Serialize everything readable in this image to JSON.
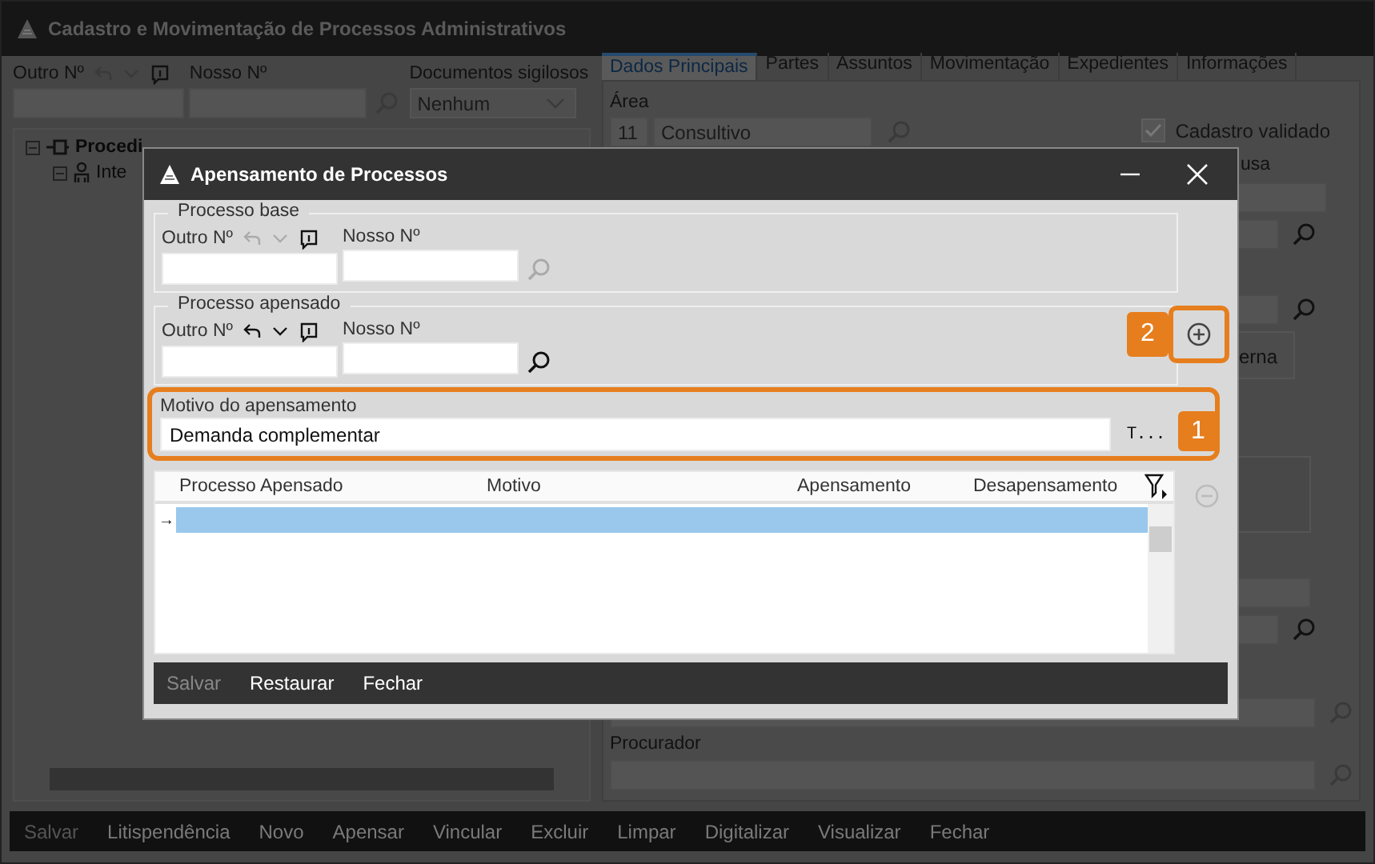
{
  "window": {
    "title": "Cadastro e Movimentação de Processos Administrativos"
  },
  "header_fields": {
    "outro_label": "Outro Nº",
    "nosso_label": "Nosso Nº",
    "sigilosos_label": "Documentos sigilosos",
    "sigilosos_value": "Nenhum"
  },
  "tree": [
    {
      "label": "Procedi",
      "expanded": true,
      "children": [
        {
          "label": "Inte",
          "expanded": true
        }
      ]
    }
  ],
  "tabs": [
    {
      "label": "Dados Principais",
      "selected": true
    },
    {
      "label": "Partes",
      "selected": false
    },
    {
      "label": "Assuntos",
      "selected": false
    },
    {
      "label": "Movimentação",
      "selected": false
    },
    {
      "label": "Expedientes",
      "selected": false
    },
    {
      "label": "Informações",
      "selected": false
    }
  ],
  "main_panel": {
    "area_label": "Área",
    "area_code": "11",
    "area_name": "Consultivo",
    "validated_label": "Cadastro validado",
    "validated": true,
    "partial_label": "usa",
    "partial_button": "erna",
    "procurador_label": "Procurador"
  },
  "toolbar": [
    {
      "label": "Salvar",
      "disabled": true
    },
    {
      "label": "Litispendência",
      "disabled": false
    },
    {
      "label": "Novo",
      "disabled": false
    },
    {
      "label": "Apensar",
      "disabled": false
    },
    {
      "label": "Vincular",
      "disabled": false
    },
    {
      "label": "Excluir",
      "disabled": false
    },
    {
      "label": "Limpar",
      "disabled": false
    },
    {
      "label": "Digitalizar",
      "disabled": false
    },
    {
      "label": "Visualizar",
      "disabled": false
    },
    {
      "label": "Fechar",
      "disabled": false
    }
  ],
  "dialog": {
    "title": "Apensamento de Processos",
    "groups": [
      {
        "title": "Processo base",
        "outro_label": "Outro Nº",
        "nosso_label": "Nosso Nº",
        "disabled": true
      },
      {
        "title": "Processo apensado",
        "outro_label": "Outro Nº",
        "nosso_label": "Nosso Nº",
        "disabled": false
      }
    ],
    "motivo": {
      "label": "Motivo do apensamento",
      "value": "Demanda complementar",
      "button": "T..."
    },
    "callouts": [
      {
        "number": "1"
      },
      {
        "number": "2"
      }
    ],
    "table": {
      "columns": [
        "Processo Apensado",
        "Motivo",
        "Apensamento",
        "Desapensamento"
      ],
      "rows": [
        {
          "marker": "→",
          "selected": true
        }
      ]
    },
    "remove_disabled": true,
    "buttons": [
      {
        "label": "Salvar",
        "disabled": true
      },
      {
        "label": "Restaurar",
        "disabled": false
      },
      {
        "label": "Fechar",
        "disabled": false
      }
    ]
  }
}
